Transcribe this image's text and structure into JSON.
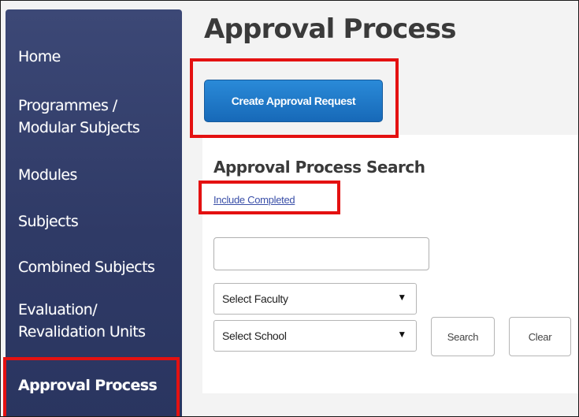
{
  "sidebar": {
    "items": [
      {
        "label": "Home"
      },
      {
        "label_line1": "Programmes /",
        "label_line2": "Modular Subjects"
      },
      {
        "label": "Modules"
      },
      {
        "label": "Subjects"
      },
      {
        "label": "Combined Subjects"
      },
      {
        "label_line1": "Evaluation/",
        "label_line2": "Revalidation Units"
      },
      {
        "label": "Approval Process",
        "active": true
      }
    ]
  },
  "main": {
    "title": "Approval Process",
    "create_button": "Create Approval Request",
    "search": {
      "title": "Approval Process Search",
      "include_completed": "Include Completed",
      "text_value": "",
      "faculty_select": "Select Faculty",
      "school_select": "Select School",
      "search_button": "Search",
      "clear_button": "Clear"
    }
  },
  "colors": {
    "sidebar_bg": "#323d6a",
    "primary_button": "#1f78c8",
    "highlight": "#e41111",
    "link": "#3a4fa8"
  },
  "icons": {
    "dropdown": "dropdown-caret-icon"
  }
}
